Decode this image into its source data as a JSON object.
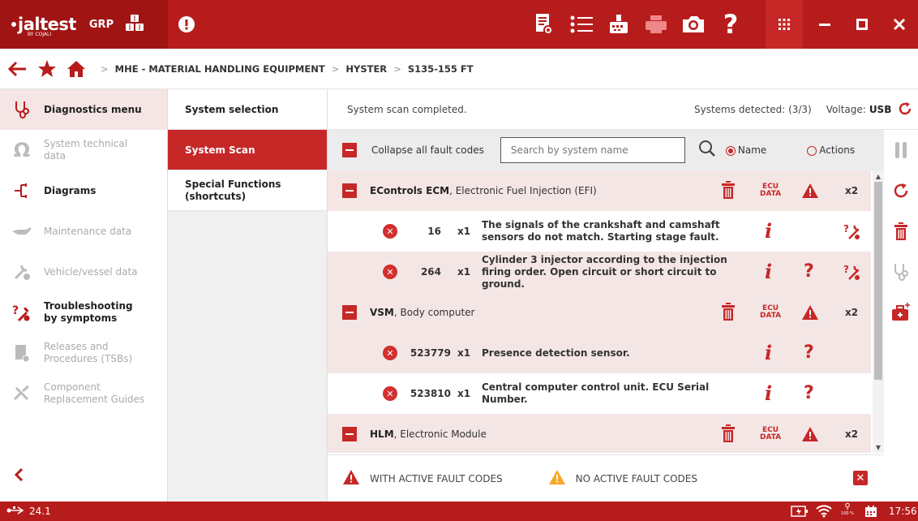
{
  "app": {
    "logo": "jaltest",
    "logo_sub": "BY COJALI",
    "mode": "GRP",
    "clock": "17:56",
    "version": "24.1",
    "zoom": "100 %"
  },
  "breadcrumb": {
    "items": [
      "MHE - MATERIAL HANDLING EQUIPMENT",
      "HYSTER",
      "S135-155 FT"
    ]
  },
  "sidebar": {
    "items": [
      {
        "label": "Diagnostics menu",
        "state": "active",
        "icon": "stethoscope-icon"
      },
      {
        "label": "System technical data",
        "state": "disabled",
        "icon": "ohm-icon"
      },
      {
        "label": "Diagrams",
        "state": "normal",
        "icon": "diagram-icon"
      },
      {
        "label": "Maintenance data",
        "state": "disabled",
        "icon": "oil-can-icon"
      },
      {
        "label": "Vehicle/vessel data",
        "state": "disabled",
        "icon": "wrench-plus-icon"
      },
      {
        "label": "Troubleshooting by symptoms",
        "state": "normal",
        "icon": "troubleshooting-icon"
      },
      {
        "label": "Releases and Procedures (TSBs)",
        "state": "disabled",
        "icon": "document-icon"
      },
      {
        "label": "Component Replacement Guides",
        "state": "disabled",
        "icon": "tools-icon"
      }
    ]
  },
  "midmenu": {
    "items": [
      {
        "label": "System selection",
        "active": false
      },
      {
        "label": "System Scan",
        "active": true
      },
      {
        "label": "Special Functions (shortcuts)",
        "active": false
      }
    ]
  },
  "scan": {
    "status": "System scan completed.",
    "systems_detected": "Systems detected: (3/3)",
    "voltage_label": "Voltage:",
    "voltage_value": "USB",
    "collapse_label": "Collapse all fault codes",
    "search_placeholder": "Search by system name",
    "radio_name": "Name",
    "radio_actions": "Actions",
    "ecu_line1": "ECU",
    "ecu_line2": "DATA",
    "systems": [
      {
        "name": "EControls ECM",
        "desc": ", Electronic Fuel Injection (EFI)",
        "count": "x2",
        "faults": [
          {
            "code": "16",
            "count": "x1",
            "desc": "The signals of the crankshaft and camshaft sensors do not match. Starting stage fault.",
            "help": false,
            "repair": true
          },
          {
            "code": "264",
            "count": "x1",
            "desc": "Cylinder 3 injector according to the injection firing order.  Open circuit or short circuit to ground.",
            "help": true,
            "repair": true
          }
        ]
      },
      {
        "name": "VSM",
        "desc": ", Body computer",
        "count": "x2",
        "faults": [
          {
            "code": "523779",
            "count": "x1",
            "desc": "Presence detection sensor.",
            "help": true,
            "repair": false
          },
          {
            "code": "523810",
            "count": "x1",
            "desc": "Central computer control unit. ECU Serial Number.",
            "help": true,
            "repair": false
          }
        ]
      },
      {
        "name": "HLM",
        "desc": ", Electronic Module",
        "count": "x2",
        "faults": []
      }
    ],
    "legend_active": "WITH ACTIVE FAULT CODES",
    "legend_inactive": "NO ACTIVE FAULT CODES"
  },
  "colors": {
    "brand_red": "#b71c1c",
    "accent_red": "#c62828",
    "warning_yellow": "#f9a825",
    "row_pink": "#f5e6e6"
  }
}
